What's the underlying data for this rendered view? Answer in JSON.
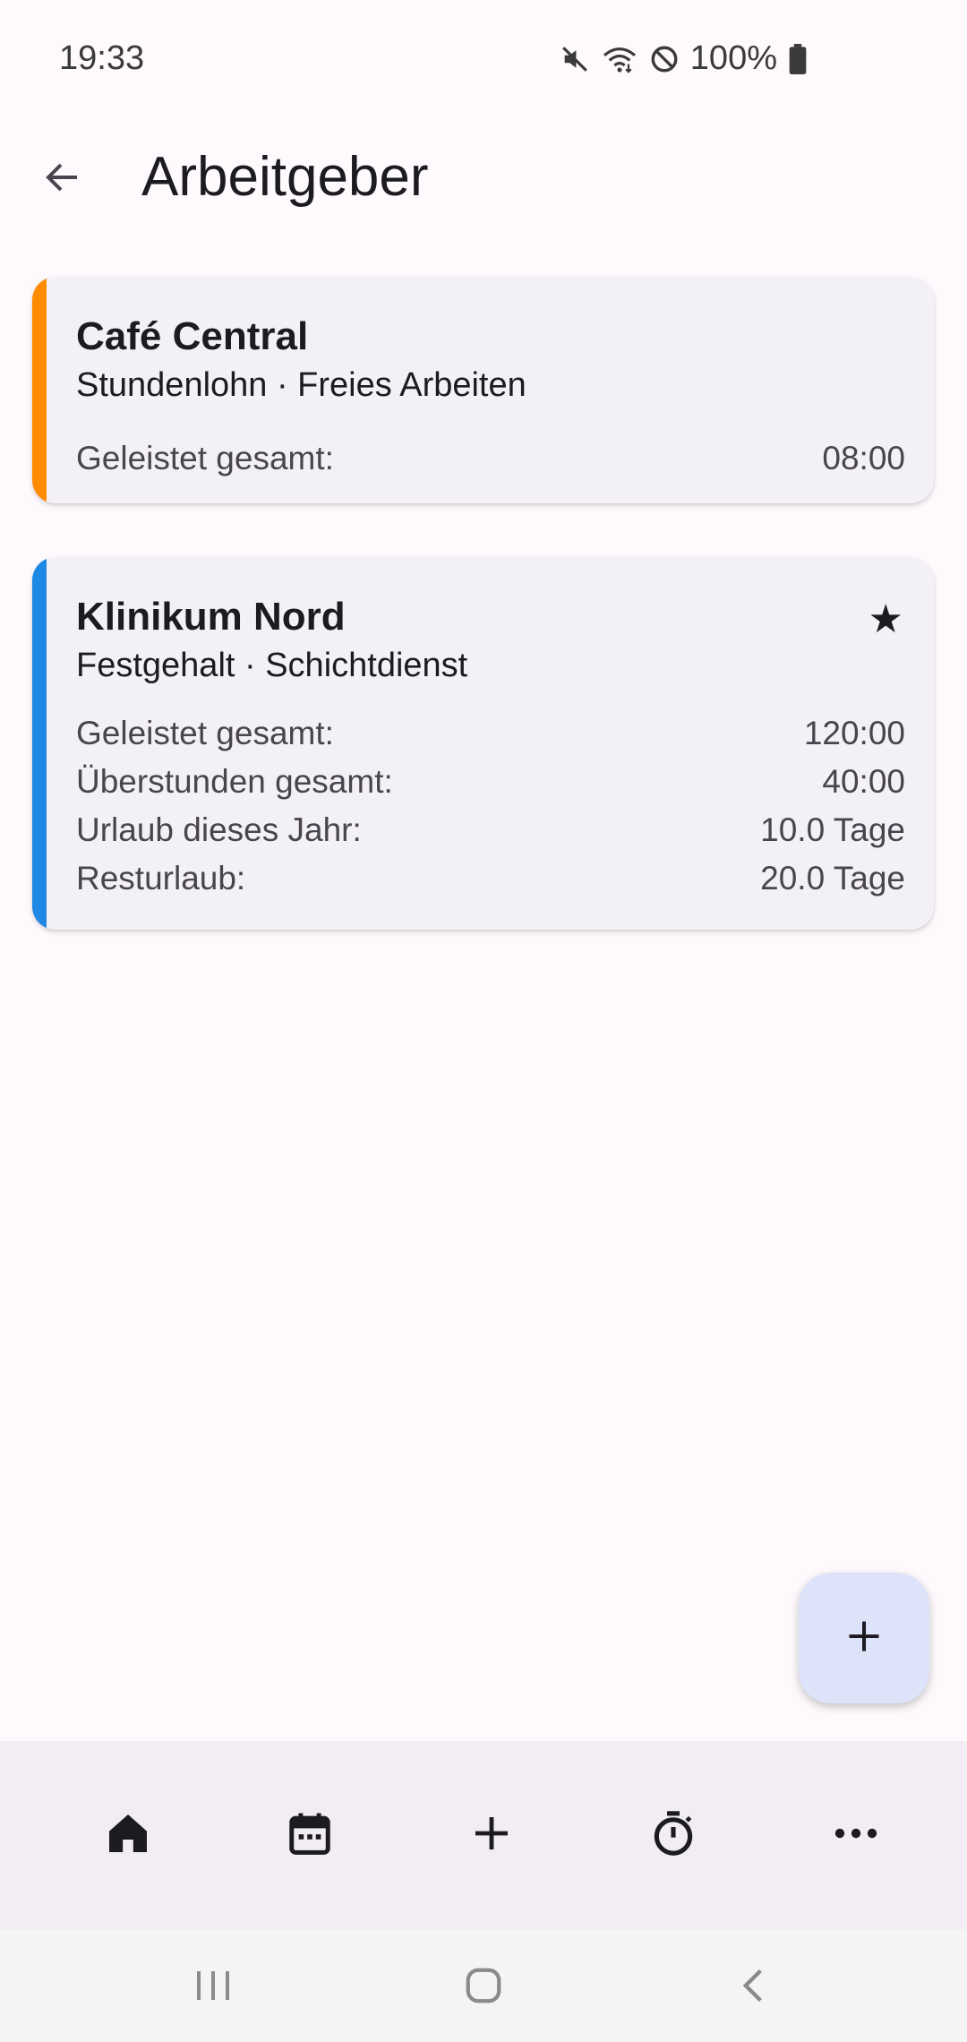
{
  "status_bar": {
    "time": "19:33",
    "battery_text": "100%",
    "icons": [
      "mute-icon",
      "wifi-icon",
      "do-not-disturb-icon",
      "battery-icon"
    ]
  },
  "app_bar": {
    "title": "Arbeitgeber",
    "back_icon": "arrow-back-icon"
  },
  "employers": [
    {
      "name": "Café Central",
      "subtitle": "Stundenlohn · Freies Arbeiten",
      "accent_color": "#FF8C00",
      "favorite": false,
      "rows": [
        {
          "label": "Geleistet gesamt:",
          "value": "08:00"
        }
      ]
    },
    {
      "name": "Klinikum Nord",
      "subtitle": "Festgehalt · Schichtdienst",
      "accent_color": "#1E88E5",
      "favorite": true,
      "favorite_icon": "★",
      "rows": [
        {
          "label": "Geleistet gesamt:",
          "value": "120:00"
        },
        {
          "label": "Überstunden gesamt:",
          "value": "40:00"
        },
        {
          "label": "Urlaub dieses Jahr:",
          "value": "10.0 Tage"
        },
        {
          "label": "Resturlaub:",
          "value": "20.0 Tage"
        }
      ]
    }
  ],
  "fab": {
    "icon": "plus-icon",
    "color": "#DDE3F9"
  },
  "bottom_nav": {
    "items": [
      {
        "icon": "home-icon"
      },
      {
        "icon": "calendar-icon"
      },
      {
        "icon": "plus-icon"
      },
      {
        "icon": "stopwatch-icon"
      },
      {
        "icon": "more-icon"
      }
    ]
  },
  "system_nav": {
    "items": [
      {
        "icon": "recent-apps-icon"
      },
      {
        "icon": "home-button-icon"
      },
      {
        "icon": "system-back-icon"
      }
    ]
  }
}
